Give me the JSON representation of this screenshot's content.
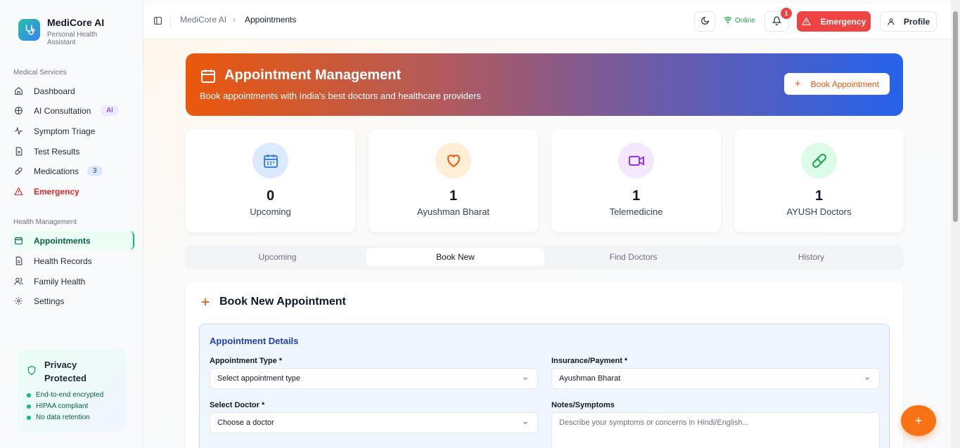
{
  "brand": {
    "name": "MediCore AI",
    "subtitle": "Personal Health Assistant"
  },
  "sidebar": {
    "section1": "Medical Services",
    "items1": [
      {
        "label": "Dashboard",
        "icon": "home-icon"
      },
      {
        "label": "AI Consultation",
        "icon": "brain-icon",
        "badge": "AI"
      },
      {
        "label": "Symptom Triage",
        "icon": "activity-icon"
      },
      {
        "label": "Test Results",
        "icon": "file-icon"
      },
      {
        "label": "Medications",
        "icon": "pill-icon",
        "badge": "3"
      },
      {
        "label": "Emergency",
        "icon": "alert-triangle-icon"
      }
    ],
    "section2": "Health Management",
    "items2": [
      {
        "label": "Appointments",
        "icon": "calendar-icon"
      },
      {
        "label": "Health Records",
        "icon": "file-icon"
      },
      {
        "label": "Family Health",
        "icon": "users-icon"
      },
      {
        "label": "Settings",
        "icon": "gear-icon"
      }
    ],
    "privacy": {
      "title": "Privacy Protected",
      "lines": [
        "End-to-end encrypted",
        "HIPAA compliant",
        "No data retention"
      ]
    }
  },
  "header": {
    "breadcrumb": [
      "MediCore AI",
      "Appointments"
    ],
    "breadcrumb_sep": "›",
    "status": "Online",
    "notifications": "1",
    "emergency": "Emergency",
    "profile": "Profile"
  },
  "hero": {
    "title": "Appointment Management",
    "subtitle": "Book appointments with India's best doctors and healthcare providers",
    "button": "Book Appointment"
  },
  "stats": [
    {
      "value": "0",
      "label": "Upcoming",
      "icon": "calendar-icon",
      "color": "#3b82f6",
      "bg": "#dbeafe"
    },
    {
      "value": "1",
      "label": "Ayushman Bharat",
      "icon": "heart-icon",
      "color": "#ea580c",
      "bg": "#ffedd5"
    },
    {
      "value": "1",
      "label": "Telemedicine",
      "icon": "video-icon",
      "color": "#9333ea",
      "bg": "#f3e8ff"
    },
    {
      "value": "1",
      "label": "AYUSH Doctors",
      "icon": "pill-icon",
      "color": "#16a34a",
      "bg": "#dcfce7"
    }
  ],
  "tabs": [
    "Upcoming",
    "Book New",
    "Find Doctors",
    "History"
  ],
  "active_tab": "Book New",
  "booking": {
    "title": "Book New Appointment",
    "section": "Appointment Details",
    "type_label": "Appointment Type *",
    "type_value": "Select appointment type",
    "insurance_label": "Insurance/Payment *",
    "insurance_value": "Ayushman Bharat",
    "doctor_label": "Select Doctor *",
    "doctor_value": "Choose a doctor",
    "notes_label": "Notes/Symptoms",
    "notes_placeholder": "Describe your symptoms or concerns in Hindi/English..."
  },
  "fab": "+"
}
